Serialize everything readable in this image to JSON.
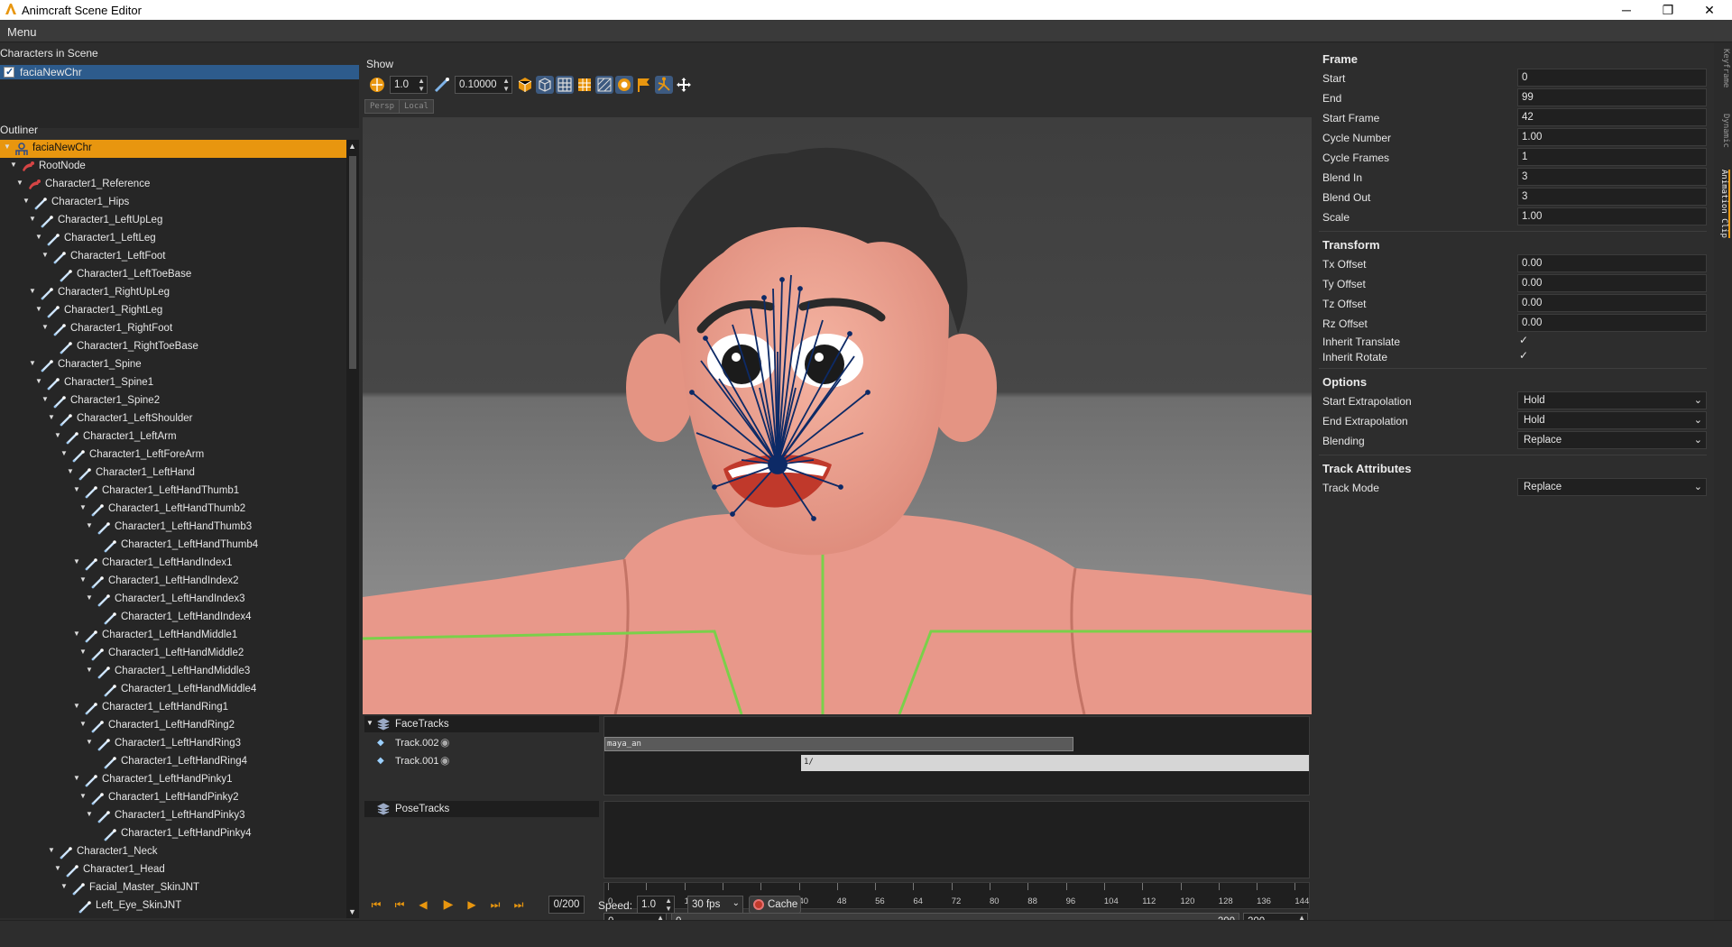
{
  "window": {
    "title": "Animcraft Scene Editor",
    "minimize": "─",
    "maximize": "❐",
    "close": "✕"
  },
  "menu": {
    "label": "Menu"
  },
  "characters": {
    "header": "Characters in Scene",
    "items": [
      {
        "label": "faciaNewChr",
        "checked": true
      }
    ]
  },
  "outliner": {
    "header": "Outliner",
    "items": [
      {
        "label": "faciaNewChr",
        "depth": 0,
        "icon": "character",
        "selected": true
      },
      {
        "label": "RootNode",
        "depth": 1,
        "icon": "root"
      },
      {
        "label": "Character1_Reference",
        "depth": 2,
        "icon": "root"
      },
      {
        "label": "Character1_Hips",
        "depth": 3,
        "icon": "bone"
      },
      {
        "label": "Character1_LeftUpLeg",
        "depth": 4,
        "icon": "bone"
      },
      {
        "label": "Character1_LeftLeg",
        "depth": 5,
        "icon": "bone"
      },
      {
        "label": "Character1_LeftFoot",
        "depth": 6,
        "icon": "bone"
      },
      {
        "label": "Character1_LeftToeBase",
        "depth": 7,
        "icon": "bone",
        "leaf": true
      },
      {
        "label": "Character1_RightUpLeg",
        "depth": 4,
        "icon": "bone"
      },
      {
        "label": "Character1_RightLeg",
        "depth": 5,
        "icon": "bone"
      },
      {
        "label": "Character1_RightFoot",
        "depth": 6,
        "icon": "bone"
      },
      {
        "label": "Character1_RightToeBase",
        "depth": 7,
        "icon": "bone",
        "leaf": true
      },
      {
        "label": "Character1_Spine",
        "depth": 4,
        "icon": "bone"
      },
      {
        "label": "Character1_Spine1",
        "depth": 5,
        "icon": "bone"
      },
      {
        "label": "Character1_Spine2",
        "depth": 6,
        "icon": "bone"
      },
      {
        "label": "Character1_LeftShoulder",
        "depth": 7,
        "icon": "bone"
      },
      {
        "label": "Character1_LeftArm",
        "depth": 8,
        "icon": "bone"
      },
      {
        "label": "Character1_LeftForeArm",
        "depth": 9,
        "icon": "bone"
      },
      {
        "label": "Character1_LeftHand",
        "depth": 10,
        "icon": "bone"
      },
      {
        "label": "Character1_LeftHandThumb1",
        "depth": 11,
        "icon": "bone"
      },
      {
        "label": "Character1_LeftHandThumb2",
        "depth": 12,
        "icon": "bone"
      },
      {
        "label": "Character1_LeftHandThumb3",
        "depth": 13,
        "icon": "bone"
      },
      {
        "label": "Character1_LeftHandThumb4",
        "depth": 14,
        "icon": "bone",
        "leaf": true
      },
      {
        "label": "Character1_LeftHandIndex1",
        "depth": 11,
        "icon": "bone"
      },
      {
        "label": "Character1_LeftHandIndex2",
        "depth": 12,
        "icon": "bone"
      },
      {
        "label": "Character1_LeftHandIndex3",
        "depth": 13,
        "icon": "bone"
      },
      {
        "label": "Character1_LeftHandIndex4",
        "depth": 14,
        "icon": "bone",
        "leaf": true
      },
      {
        "label": "Character1_LeftHandMiddle1",
        "depth": 11,
        "icon": "bone"
      },
      {
        "label": "Character1_LeftHandMiddle2",
        "depth": 12,
        "icon": "bone"
      },
      {
        "label": "Character1_LeftHandMiddle3",
        "depth": 13,
        "icon": "bone"
      },
      {
        "label": "Character1_LeftHandMiddle4",
        "depth": 14,
        "icon": "bone",
        "leaf": true
      },
      {
        "label": "Character1_LeftHandRing1",
        "depth": 11,
        "icon": "bone"
      },
      {
        "label": "Character1_LeftHandRing2",
        "depth": 12,
        "icon": "bone"
      },
      {
        "label": "Character1_LeftHandRing3",
        "depth": 13,
        "icon": "bone"
      },
      {
        "label": "Character1_LeftHandRing4",
        "depth": 14,
        "icon": "bone",
        "leaf": true
      },
      {
        "label": "Character1_LeftHandPinky1",
        "depth": 11,
        "icon": "bone"
      },
      {
        "label": "Character1_LeftHandPinky2",
        "depth": 12,
        "icon": "bone"
      },
      {
        "label": "Character1_LeftHandPinky3",
        "depth": 13,
        "icon": "bone"
      },
      {
        "label": "Character1_LeftHandPinky4",
        "depth": 14,
        "icon": "bone",
        "leaf": true
      },
      {
        "label": "Character1_Neck",
        "depth": 7,
        "icon": "bone"
      },
      {
        "label": "Character1_Head",
        "depth": 8,
        "icon": "bone"
      },
      {
        "label": "Facial_Master_SkinJNT",
        "depth": 9,
        "icon": "bone"
      },
      {
        "label": "Left_Eye_SkinJNT",
        "depth": 10,
        "icon": "bone",
        "leaf": true
      }
    ]
  },
  "viewport": {
    "show_label": "Show",
    "scale_value": "1.0",
    "step_value": "0.10000",
    "persp_button": "Persp",
    "local_button": "Local"
  },
  "timeline": {
    "face_tracks_label": "FaceTracks",
    "tracks": [
      {
        "label": "Track.002"
      },
      {
        "label": "Track.001"
      }
    ],
    "pose_tracks_label": "PoseTracks",
    "clip_label": "maya_an",
    "clip_marker": "1/",
    "ruler_ticks": [
      "0",
      "8",
      "16",
      "24",
      "32",
      "40",
      "48",
      "56",
      "64",
      "72",
      "80",
      "88",
      "96",
      "104",
      "112",
      "120",
      "128",
      "136",
      "144"
    ],
    "range_start": "0",
    "range_left_value": "0",
    "range_right_value": "200",
    "range_end": "200"
  },
  "playback": {
    "frame_counter": "0/200",
    "speed_label": "Speed:",
    "speed_value": "1.0",
    "fps_value": "30 fps",
    "cache_label": "Cache"
  },
  "properties": {
    "frame": {
      "header": "Frame",
      "fields": [
        {
          "label": "Start",
          "value": "0"
        },
        {
          "label": "End",
          "value": "99"
        },
        {
          "label": "Start Frame",
          "value": "42"
        },
        {
          "label": "Cycle Number",
          "value": "1.00"
        },
        {
          "label": "Cycle Frames",
          "value": "1"
        },
        {
          "label": "Blend In",
          "value": "3"
        },
        {
          "label": "Blend Out",
          "value": "3"
        },
        {
          "label": "Scale",
          "value": "1.00"
        }
      ]
    },
    "transform": {
      "header": "Transform",
      "fields": [
        {
          "label": "Tx Offset",
          "value": "0.00"
        },
        {
          "label": "Ty Offset",
          "value": "0.00"
        },
        {
          "label": "Tz Offset",
          "value": "0.00"
        },
        {
          "label": "Rz Offset",
          "value": "0.00"
        }
      ],
      "checks": [
        {
          "label": "Inherit Translate",
          "checked": true
        },
        {
          "label": "Inherit Rotate",
          "checked": true
        }
      ]
    },
    "options": {
      "header": "Options",
      "fields": [
        {
          "label": "Start Extrapolation",
          "value": "Hold"
        },
        {
          "label": "End Extrapolation",
          "value": "Hold"
        },
        {
          "label": "Blending",
          "value": "Replace"
        }
      ]
    },
    "track_attributes": {
      "header": "Track Attributes",
      "fields": [
        {
          "label": "Track Mode",
          "value": "Replace"
        }
      ]
    }
  },
  "side_tabs": [
    "Keyframe",
    "Dynamic",
    "Animation Clip"
  ],
  "colors": {
    "accent": "#e8960f",
    "selection_blue": "#2d5b8c",
    "bone_lines": "#0d2a66",
    "grid_green": "#7ad04a",
    "skin": "#e8988a"
  }
}
